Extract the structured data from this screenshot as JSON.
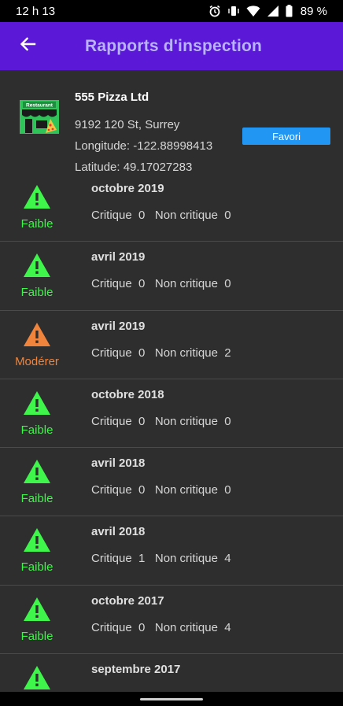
{
  "status_bar": {
    "time": "12 h 13",
    "battery": "89 %"
  },
  "app_bar": {
    "title": "Rapports d'inspection",
    "back_icon": "arrow-left-icon"
  },
  "restaurant": {
    "name": "555 Pizza Ltd",
    "address": "9192 120 St, Surrey",
    "longitude_text": "Longitude:  -122.88998413",
    "latitude_text": "Latitude:  49.17027283",
    "favorite_label": "Favori",
    "logo_sign": "Restaurant"
  },
  "colors": {
    "low": "#3ff44b",
    "moderate": "#f0843c",
    "accent": "#2196f3",
    "app_bar": "#5b18d6"
  },
  "inspections": [
    {
      "date": "octobre 2019",
      "counts": "Critique  0   Non critique  0",
      "hazard": "Faible",
      "level": "low"
    },
    {
      "date": "avril 2019",
      "counts": "Critique  0   Non critique  0",
      "hazard": "Faible",
      "level": "low"
    },
    {
      "date": "avril 2019",
      "counts": "Critique  0   Non critique  2",
      "hazard": "Modérer",
      "level": "moderate"
    },
    {
      "date": "octobre 2018",
      "counts": "Critique  0   Non critique  0",
      "hazard": "Faible",
      "level": "low"
    },
    {
      "date": "avril 2018",
      "counts": "Critique  0   Non critique  0",
      "hazard": "Faible",
      "level": "low"
    },
    {
      "date": "avril 2018",
      "counts": "Critique  1   Non critique  4",
      "hazard": "Faible",
      "level": "low"
    },
    {
      "date": "octobre 2017",
      "counts": "Critique  0   Non critique  4",
      "hazard": "Faible",
      "level": "low"
    },
    {
      "date": "septembre 2017",
      "counts": "",
      "hazard": "",
      "level": "low"
    }
  ]
}
